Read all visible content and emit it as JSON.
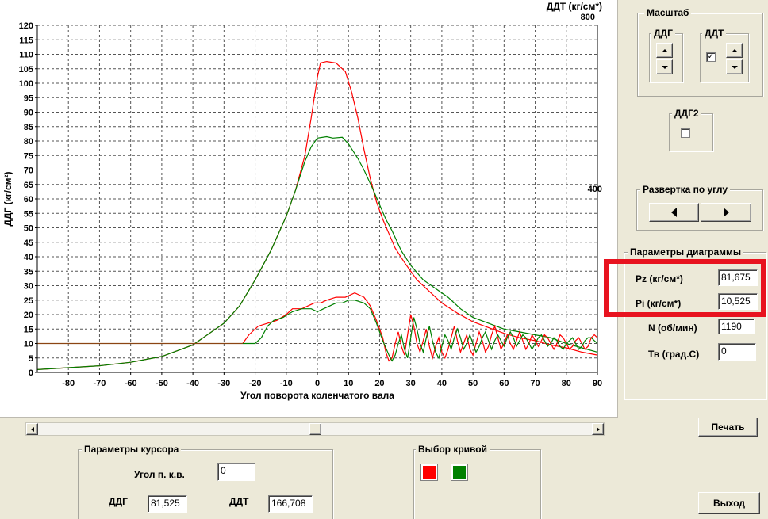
{
  "chart_data": {
    "type": "line",
    "xlabel": "Угол поворота коленчатого вала",
    "ylabel": "ДДГ (кг/см²)",
    "right_axis_title": "ДДТ (кг/см*)",
    "right_ticks": [
      "800",
      "400"
    ],
    "xlim": [
      -90,
      90
    ],
    "ylim": [
      0,
      120
    ],
    "grid": true,
    "x_ticks": [
      -80,
      -70,
      -60,
      -50,
      -40,
      -30,
      -20,
      -10,
      0,
      10,
      20,
      30,
      40,
      50,
      60,
      70,
      80,
      90
    ],
    "y_ticks": [
      0,
      5,
      10,
      15,
      20,
      25,
      30,
      35,
      40,
      45,
      50,
      55,
      60,
      65,
      70,
      75,
      80,
      85,
      90,
      95,
      100,
      105,
      110,
      115,
      120
    ],
    "series": [
      {
        "color": "#ff0000",
        "points": [
          [
            -90,
            1
          ],
          [
            -70,
            2.3
          ],
          [
            -60,
            3.5
          ],
          [
            -50,
            5.5
          ],
          [
            -40,
            9.5
          ],
          [
            -30,
            17
          ],
          [
            -25,
            23
          ],
          [
            -20,
            32
          ],
          [
            -15,
            42
          ],
          [
            -10,
            54
          ],
          [
            -7,
            63
          ],
          [
            -4,
            75
          ],
          [
            -2,
            88
          ],
          [
            0,
            102
          ],
          [
            1,
            107
          ],
          [
            3,
            107.5
          ],
          [
            6,
            107
          ],
          [
            9,
            104
          ],
          [
            11,
            97
          ],
          [
            13,
            88
          ],
          [
            15,
            77
          ],
          [
            17,
            67
          ],
          [
            19,
            59
          ],
          [
            21,
            53
          ],
          [
            23,
            48
          ],
          [
            25,
            43
          ],
          [
            28,
            38
          ],
          [
            32,
            32
          ],
          [
            36,
            28
          ],
          [
            40,
            24
          ],
          [
            45,
            20.5
          ],
          [
            50,
            17.5
          ],
          [
            55,
            15.5
          ],
          [
            60,
            13.5
          ],
          [
            65,
            12
          ],
          [
            70,
            11
          ],
          [
            75,
            9.5
          ],
          [
            80,
            8.5
          ],
          [
            85,
            7
          ],
          [
            90,
            6
          ]
        ]
      },
      {
        "color": "#008000",
        "points": [
          [
            -90,
            1
          ],
          [
            -70,
            2.3
          ],
          [
            -60,
            3.5
          ],
          [
            -50,
            5.5
          ],
          [
            -40,
            9.5
          ],
          [
            -30,
            17
          ],
          [
            -25,
            23
          ],
          [
            -20,
            32
          ],
          [
            -15,
            42
          ],
          [
            -10,
            54
          ],
          [
            -7,
            63
          ],
          [
            -4,
            73
          ],
          [
            -2,
            78
          ],
          [
            0,
            81
          ],
          [
            3,
            81.5
          ],
          [
            5,
            81
          ],
          [
            8,
            81.3
          ],
          [
            10,
            79
          ],
          [
            13,
            74
          ],
          [
            15,
            70
          ],
          [
            18,
            63
          ],
          [
            20,
            58
          ],
          [
            22,
            53
          ],
          [
            24,
            49
          ],
          [
            27,
            42
          ],
          [
            30,
            37
          ],
          [
            34,
            32
          ],
          [
            38,
            29
          ],
          [
            42,
            26
          ],
          [
            46,
            22
          ],
          [
            50,
            19
          ],
          [
            55,
            17
          ],
          [
            60,
            15
          ],
          [
            65,
            14
          ],
          [
            70,
            13
          ],
          [
            75,
            12
          ],
          [
            80,
            10
          ],
          [
            85,
            8.5
          ],
          [
            90,
            7
          ]
        ]
      },
      {
        "color": "#ff0000",
        "points": [
          [
            -24,
            10
          ],
          [
            -22,
            13
          ],
          [
            -19,
            16
          ],
          [
            -16,
            17
          ],
          [
            -13,
            18
          ],
          [
            -10,
            20
          ],
          [
            -8,
            22
          ],
          [
            -5,
            22
          ],
          [
            -3,
            23
          ],
          [
            -1,
            24
          ],
          [
            1,
            24
          ],
          [
            3,
            25
          ],
          [
            6,
            26
          ],
          [
            9,
            26
          ],
          [
            12,
            27.5
          ],
          [
            15,
            26
          ],
          [
            17,
            23
          ],
          [
            19,
            18
          ],
          [
            21,
            12
          ],
          [
            22,
            7
          ],
          [
            23,
            4
          ],
          [
            24,
            5
          ],
          [
            25,
            10
          ],
          [
            26,
            14
          ],
          [
            27,
            9
          ],
          [
            28,
            6
          ],
          [
            29,
            13
          ],
          [
            30,
            20
          ],
          [
            31,
            16
          ],
          [
            32,
            10
          ],
          [
            33,
            7
          ],
          [
            34,
            11
          ],
          [
            35,
            15
          ],
          [
            36,
            9
          ],
          [
            37,
            5
          ],
          [
            38,
            9
          ],
          [
            39,
            12
          ],
          [
            40,
            7
          ],
          [
            41,
            5
          ],
          [
            42,
            8
          ],
          [
            43,
            12
          ],
          [
            44,
            16
          ],
          [
            45,
            11
          ],
          [
            46,
            7
          ],
          [
            47,
            10
          ],
          [
            48,
            13
          ],
          [
            49,
            8
          ],
          [
            50,
            6
          ],
          [
            51,
            10
          ],
          [
            52,
            14
          ],
          [
            53,
            11
          ],
          [
            54,
            7
          ],
          [
            55,
            9
          ],
          [
            56,
            13
          ],
          [
            57,
            16
          ],
          [
            58,
            12
          ],
          [
            59,
            8
          ],
          [
            60,
            10
          ],
          [
            61,
            13
          ],
          [
            62,
            10
          ],
          [
            63,
            8
          ],
          [
            64,
            11
          ],
          [
            65,
            14
          ],
          [
            66,
            11
          ],
          [
            67,
            8
          ],
          [
            68,
            10
          ],
          [
            69,
            13
          ],
          [
            70,
            11
          ],
          [
            71,
            9
          ],
          [
            72,
            11
          ],
          [
            73,
            13
          ],
          [
            74,
            12
          ],
          [
            75,
            10
          ],
          [
            76,
            8
          ],
          [
            77,
            10
          ],
          [
            78,
            13
          ],
          [
            79,
            12
          ],
          [
            80,
            10
          ],
          [
            81,
            8
          ],
          [
            82,
            9
          ],
          [
            83,
            11
          ],
          [
            84,
            12
          ],
          [
            85,
            10
          ],
          [
            86,
            8
          ],
          [
            87,
            9
          ],
          [
            88,
            12
          ],
          [
            89,
            13
          ],
          [
            90,
            12
          ]
        ]
      },
      {
        "color": "#008000",
        "points": [
          [
            -24,
            10
          ],
          [
            -20,
            10
          ],
          [
            -18,
            12
          ],
          [
            -16,
            16
          ],
          [
            -14,
            18
          ],
          [
            -11,
            19
          ],
          [
            -8,
            21
          ],
          [
            -5,
            22
          ],
          [
            -2,
            22
          ],
          [
            0,
            21
          ],
          [
            2,
            22
          ],
          [
            4,
            23
          ],
          [
            6,
            24
          ],
          [
            8,
            24
          ],
          [
            10,
            25
          ],
          [
            12,
            25
          ],
          [
            15,
            24
          ],
          [
            17,
            22
          ],
          [
            19,
            17
          ],
          [
            21,
            11
          ],
          [
            23,
            6
          ],
          [
            24,
            4
          ],
          [
            25,
            6
          ],
          [
            26,
            10
          ],
          [
            27,
            13
          ],
          [
            28,
            8
          ],
          [
            29,
            5
          ],
          [
            30,
            12
          ],
          [
            31,
            19
          ],
          [
            32,
            15
          ],
          [
            33,
            10
          ],
          [
            34,
            7
          ],
          [
            35,
            12
          ],
          [
            36,
            16
          ],
          [
            37,
            11
          ],
          [
            38,
            7
          ],
          [
            39,
            5
          ],
          [
            40,
            9
          ],
          [
            41,
            13
          ],
          [
            42,
            11
          ],
          [
            43,
            8
          ],
          [
            44,
            12
          ],
          [
            45,
            15
          ],
          [
            46,
            12
          ],
          [
            47,
            8
          ],
          [
            48,
            10
          ],
          [
            49,
            13
          ],
          [
            50,
            10
          ],
          [
            51,
            7
          ],
          [
            52,
            9
          ],
          [
            53,
            12
          ],
          [
            54,
            14
          ],
          [
            55,
            11
          ],
          [
            56,
            8
          ],
          [
            57,
            11
          ],
          [
            58,
            13
          ],
          [
            59,
            11
          ],
          [
            60,
            9
          ],
          [
            61,
            12
          ],
          [
            62,
            14
          ],
          [
            63,
            12
          ],
          [
            64,
            9
          ],
          [
            65,
            11
          ],
          [
            66,
            13
          ],
          [
            67,
            12
          ],
          [
            68,
            10
          ],
          [
            69,
            8
          ],
          [
            70,
            10
          ],
          [
            71,
            12
          ],
          [
            72,
            13
          ],
          [
            73,
            11
          ],
          [
            74,
            9
          ],
          [
            75,
            10
          ],
          [
            76,
            12
          ],
          [
            77,
            11
          ],
          [
            78,
            9
          ],
          [
            79,
            8
          ],
          [
            80,
            10
          ],
          [
            81,
            11
          ],
          [
            82,
            12
          ],
          [
            83,
            10
          ],
          [
            84,
            8
          ],
          [
            85,
            9
          ],
          [
            86,
            11
          ],
          [
            87,
            12
          ],
          [
            88,
            12
          ],
          [
            89,
            11
          ],
          [
            90,
            10
          ]
        ]
      },
      {
        "color": "#8b4513",
        "points": [
          [
            -90,
            10
          ],
          [
            -24,
            10
          ]
        ]
      }
    ]
  },
  "scale_group": {
    "title": "Масштаб",
    "ddg_title": "ДДГ",
    "ddt_title": "ДДТ",
    "ddt_checkbox": "✓"
  },
  "ddg2_group": {
    "title": "ДДГ2"
  },
  "sweep_group": {
    "title": "Развертка по углу"
  },
  "params_group": {
    "title": "Параметры диаграммы",
    "pz_label": "Pz (кг/см*)",
    "pz_value": "81,675",
    "pi_label": "Pi (кг/см*)",
    "pi_value": "10,525",
    "n_label": "N (об/мин)",
    "n_value": "1190",
    "tv_label": "Тв (град.С)",
    "tv_value": "0",
    "highlight_color": "#e8131f"
  },
  "cursor_group": {
    "title": "Параметры курсора",
    "angle_label": "Угол п. к.в.",
    "angle_value": "0",
    "ddg_label": "ДДГ",
    "ddg_value": "81,525",
    "ddt_label": "ДДТ",
    "ddt_value": "166,708"
  },
  "curve_group": {
    "title": "Выбор кривой",
    "color1": "#ff0000",
    "color2": "#008000"
  },
  "buttons": {
    "print": "Печать",
    "exit": "Выход"
  }
}
